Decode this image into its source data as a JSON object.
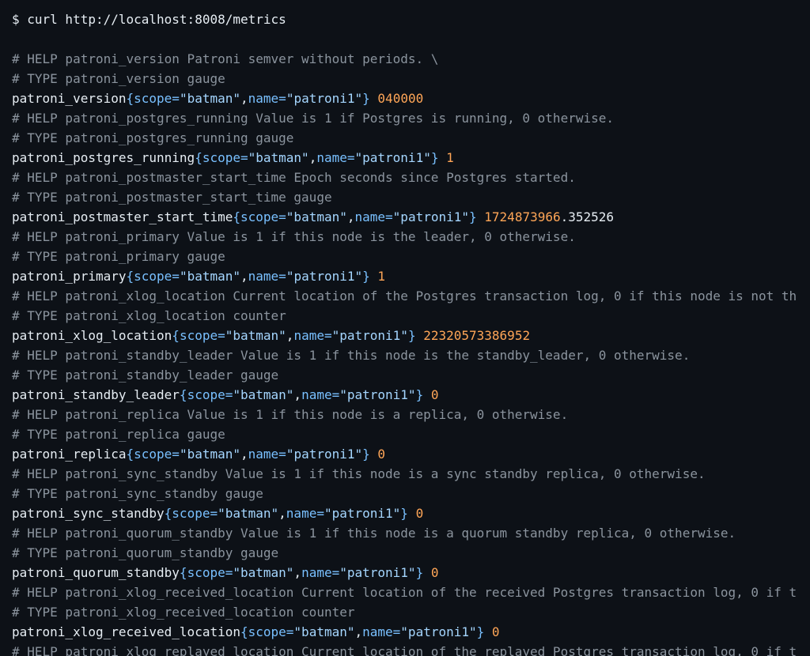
{
  "command": "$ curl http://localhost:8008/metrics",
  "lines": [
    {
      "kind": "comment",
      "text": "# HELP patroni_version Patroni semver without periods. \\"
    },
    {
      "kind": "comment",
      "text": "# TYPE patroni_version gauge"
    },
    {
      "kind": "metric",
      "name": "patroni_version",
      "scope": "\"batman\"",
      "node": "\"patroni1\"",
      "value": "040000",
      "value_rest": ""
    },
    {
      "kind": "comment",
      "text": "# HELP patroni_postgres_running Value is 1 if Postgres is running, 0 otherwise."
    },
    {
      "kind": "comment",
      "text": "# TYPE patroni_postgres_running gauge"
    },
    {
      "kind": "metric",
      "name": "patroni_postgres_running",
      "scope": "\"batman\"",
      "node": "\"patroni1\"",
      "value": "1",
      "value_rest": ""
    },
    {
      "kind": "comment",
      "text": "# HELP patroni_postmaster_start_time Epoch seconds since Postgres started."
    },
    {
      "kind": "comment",
      "text": "# TYPE patroni_postmaster_start_time gauge"
    },
    {
      "kind": "metric",
      "name": "patroni_postmaster_start_time",
      "scope": "\"batman\"",
      "node": "\"patroni1\"",
      "value": "1724873966",
      "value_rest": ".352526"
    },
    {
      "kind": "comment",
      "text": "# HELP patroni_primary Value is 1 if this node is the leader, 0 otherwise."
    },
    {
      "kind": "comment",
      "text": "# TYPE patroni_primary gauge"
    },
    {
      "kind": "metric",
      "name": "patroni_primary",
      "scope": "\"batman\"",
      "node": "\"patroni1\"",
      "value": "1",
      "value_rest": ""
    },
    {
      "kind": "comment",
      "text": "# HELP patroni_xlog_location Current location of the Postgres transaction log, 0 if this node is not th"
    },
    {
      "kind": "comment",
      "text": "# TYPE patroni_xlog_location counter"
    },
    {
      "kind": "metric",
      "name": "patroni_xlog_location",
      "scope": "\"batman\"",
      "node": "\"patroni1\"",
      "value": "22320573386952",
      "value_rest": ""
    },
    {
      "kind": "comment",
      "text": "# HELP patroni_standby_leader Value is 1 if this node is the standby_leader, 0 otherwise."
    },
    {
      "kind": "comment",
      "text": "# TYPE patroni_standby_leader gauge"
    },
    {
      "kind": "metric",
      "name": "patroni_standby_leader",
      "scope": "\"batman\"",
      "node": "\"patroni1\"",
      "value": "0",
      "value_rest": ""
    },
    {
      "kind": "comment",
      "text": "# HELP patroni_replica Value is 1 if this node is a replica, 0 otherwise."
    },
    {
      "kind": "comment",
      "text": "# TYPE patroni_replica gauge"
    },
    {
      "kind": "metric",
      "name": "patroni_replica",
      "scope": "\"batman\"",
      "node": "\"patroni1\"",
      "value": "0",
      "value_rest": ""
    },
    {
      "kind": "comment",
      "text": "# HELP patroni_sync_standby Value is 1 if this node is a sync standby replica, 0 otherwise."
    },
    {
      "kind": "comment",
      "text": "# TYPE patroni_sync_standby gauge"
    },
    {
      "kind": "metric",
      "name": "patroni_sync_standby",
      "scope": "\"batman\"",
      "node": "\"patroni1\"",
      "value": "0",
      "value_rest": ""
    },
    {
      "kind": "comment",
      "text": "# HELP patroni_quorum_standby Value is 1 if this node is a quorum standby replica, 0 otherwise."
    },
    {
      "kind": "comment",
      "text": "# TYPE patroni_quorum_standby gauge"
    },
    {
      "kind": "metric",
      "name": "patroni_quorum_standby",
      "scope": "\"batman\"",
      "node": "\"patroni1\"",
      "value": "0",
      "value_rest": ""
    },
    {
      "kind": "comment",
      "text": "# HELP patroni_xlog_received_location Current location of the received Postgres transaction log, 0 if t"
    },
    {
      "kind": "comment",
      "text": "# TYPE patroni_xlog_received_location counter"
    },
    {
      "kind": "metric",
      "name": "patroni_xlog_received_location",
      "scope": "\"batman\"",
      "node": "\"patroni1\"",
      "value": "0",
      "value_rest": ""
    },
    {
      "kind": "comment",
      "text": "# HELP patroni_xlog_replayed_location Current location of the replayed Postgres transaction log, 0 if t"
    }
  ],
  "labels": {
    "scope_key": "scope=",
    "name_key": "name=",
    "open_brace": "{",
    "close_brace": "}",
    "comma": ","
  }
}
